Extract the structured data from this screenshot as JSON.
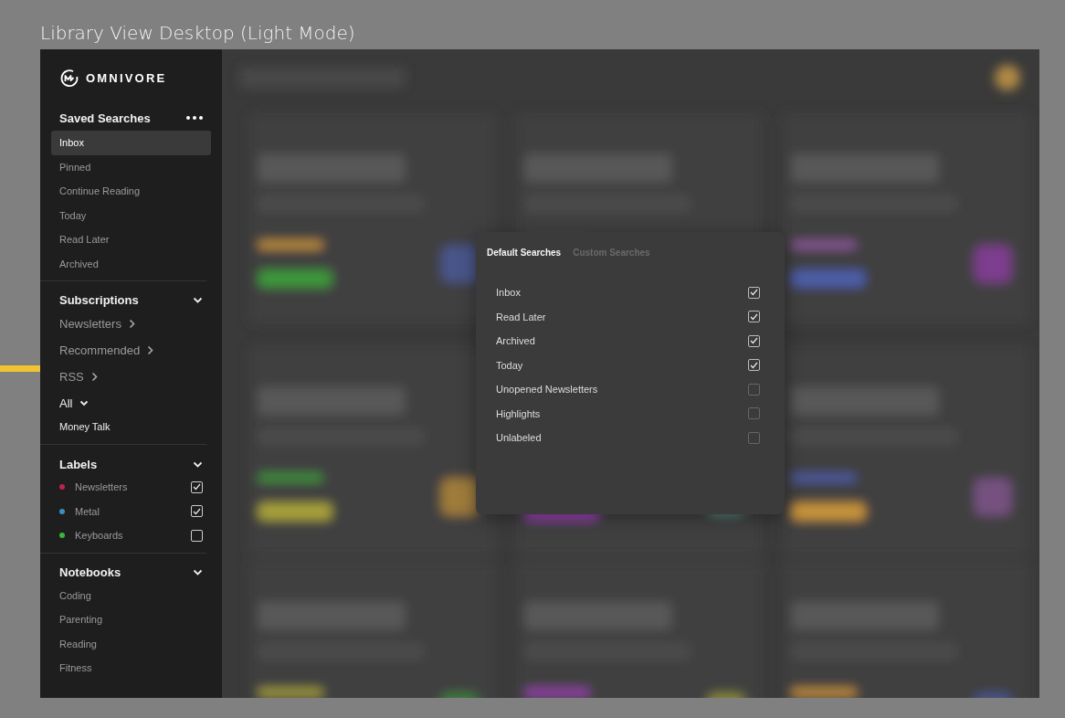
{
  "page_title": "Library View Desktop (Light Mode)",
  "sidebar": {
    "logo_text": "OMNIVORE",
    "saved_searches": {
      "title": "Saved Searches",
      "items": [
        {
          "label": "Inbox",
          "selected": true
        },
        {
          "label": "Pinned",
          "selected": false
        },
        {
          "label": "Continue Reading",
          "selected": false
        },
        {
          "label": "Today",
          "selected": false
        },
        {
          "label": "Read Later",
          "selected": false
        },
        {
          "label": "Archived",
          "selected": false
        }
      ]
    },
    "subscriptions": {
      "title": "Subscriptions",
      "expanded": true,
      "items": [
        {
          "label": "Newsletters",
          "kind": "link"
        },
        {
          "label": "Recommended",
          "kind": "link"
        },
        {
          "label": "RSS",
          "kind": "link"
        },
        {
          "label": "All",
          "kind": "dropdown"
        },
        {
          "label": "Money Talk",
          "kind": "entry"
        }
      ]
    },
    "labels": {
      "title": "Labels",
      "expanded": true,
      "items": [
        {
          "label": "Newsletters",
          "color": "#c2204d",
          "checked": true
        },
        {
          "label": "Metal",
          "color": "#3a8fc0",
          "checked": true
        },
        {
          "label": "Keyboards",
          "color": "#3fb53a",
          "checked": false
        }
      ]
    },
    "notebooks": {
      "title": "Notebooks",
      "expanded": true,
      "items": [
        {
          "label": "Coding"
        },
        {
          "label": "Parenting"
        },
        {
          "label": "Reading"
        },
        {
          "label": "Fitness"
        }
      ]
    }
  },
  "popup": {
    "tabs": [
      {
        "label": "Default Searches",
        "selected": true
      },
      {
        "label": "Custom Searches",
        "selected": false
      }
    ],
    "items": [
      {
        "label": "Inbox",
        "checked": true
      },
      {
        "label": "Read Later",
        "checked": true
      },
      {
        "label": "Archived",
        "checked": true
      },
      {
        "label": "Today",
        "checked": true
      },
      {
        "label": "Unopened Newsletters",
        "checked": false
      },
      {
        "label": "Highlights",
        "checked": false
      },
      {
        "label": "Unlabeled",
        "checked": false
      }
    ]
  }
}
